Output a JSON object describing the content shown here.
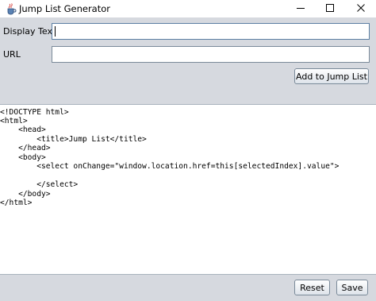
{
  "window": {
    "title": "Jump List Generator",
    "controls": [
      "minimize",
      "maximize",
      "close"
    ]
  },
  "form": {
    "display_text_label": "Display Text",
    "display_text_value": "",
    "url_label": "URL",
    "url_value": "",
    "add_button_label": "Add to Jump List"
  },
  "code": {
    "lines": [
      "<!DOCTYPE html>",
      "<html>",
      "    <head>",
      "        <title>Jump List</title>",
      "    </head>",
      "    <body>",
      "        <select onChange=\"window.location.href=this[selectedIndex].value\">",
      "",
      "        </select>",
      "    </body>",
      "</html>"
    ]
  },
  "footer": {
    "reset_label": "Reset",
    "save_label": "Save"
  },
  "icons": {
    "app": "java-cup-icon",
    "minimize": "minimize-icon",
    "maximize": "maximize-icon",
    "close": "close-icon"
  }
}
